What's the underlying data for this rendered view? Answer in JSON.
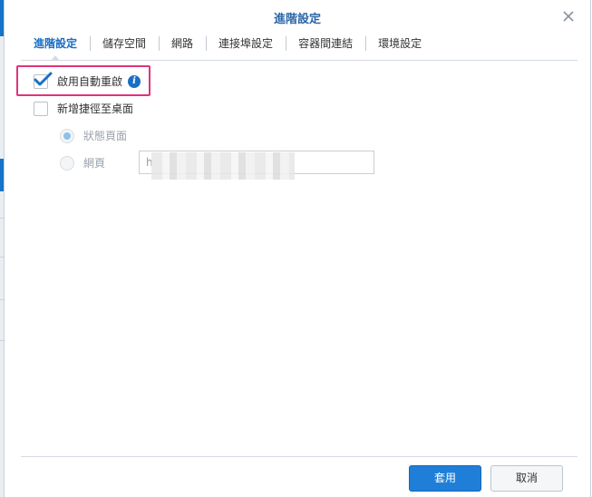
{
  "dialog": {
    "title": "進階設定",
    "close_icon": "close-icon"
  },
  "tabs": [
    {
      "label": "進階設定",
      "active": true
    },
    {
      "label": "儲存空間",
      "active": false
    },
    {
      "label": "網路",
      "active": false
    },
    {
      "label": "連接埠設定",
      "active": false
    },
    {
      "label": "容器間連結",
      "active": false
    },
    {
      "label": "環境設定",
      "active": false
    }
  ],
  "options": {
    "auto_restart": {
      "label": "啟用自動重啟",
      "checked": true,
      "info_icon": "info-icon"
    },
    "desktop_shortcut": {
      "label": "新增捷徑至桌面",
      "checked": false
    },
    "status_page": {
      "label": "狀態頁面",
      "selected": true
    },
    "web_page": {
      "label": "網頁",
      "selected": false
    },
    "url_value": "h"
  },
  "footer": {
    "apply_label": "套用",
    "cancel_label": "取消"
  },
  "colors": {
    "accent": "#1a6fc4",
    "highlight": "#e0337b"
  }
}
